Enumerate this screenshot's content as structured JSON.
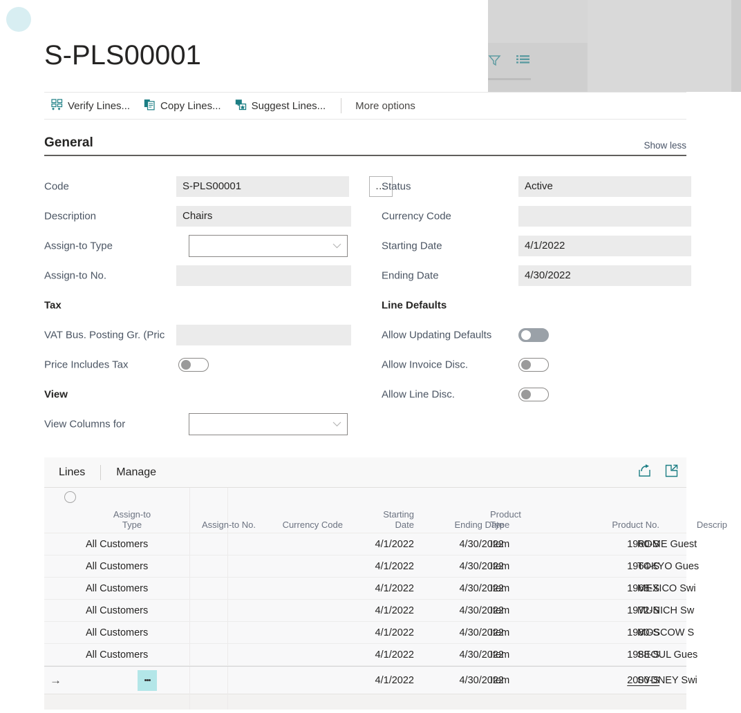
{
  "window": {
    "title": "S-PLS00001"
  },
  "avatar": {
    "color": "#d8eef2"
  },
  "background_panel": {
    "filter_icon": "filter-icon",
    "list_icon": "list-icon"
  },
  "commandbar": {
    "items": [
      {
        "label": "Verify Lines...",
        "icon": "verify-lines-icon"
      },
      {
        "label": "Copy Lines...",
        "icon": "copy-lines-icon"
      },
      {
        "label": "Suggest Lines...",
        "icon": "suggest-lines-icon"
      }
    ],
    "more_options": "More options"
  },
  "general": {
    "title": "General",
    "show_less": "Show less",
    "left": {
      "code_label": "Code",
      "code_value": "S-PLS00001",
      "assist_button": "…",
      "description_label": "Description",
      "description_value": "Chairs",
      "assign_to_type_label": "Assign-to Type",
      "assign_to_type_value": "",
      "assign_to_no_label": "Assign-to No.",
      "assign_to_no_value": "",
      "tax_heading": "Tax",
      "vat_label": "VAT Bus. Posting Gr. (Pric",
      "vat_value": "",
      "price_includes_tax_label": "Price Includes Tax",
      "price_includes_tax_on": false,
      "view_heading": "View",
      "view_columns_for_label": "View Columns for",
      "view_columns_for_value": ""
    },
    "right": {
      "status_label": "Status",
      "status_value": "Active",
      "currency_code_label": "Currency Code",
      "currency_code_value": "",
      "starting_date_label": "Starting Date",
      "starting_date_value": "4/1/2022",
      "ending_date_label": "Ending Date",
      "ending_date_value": "4/30/2022",
      "line_defaults_heading": "Line Defaults",
      "allow_updating_defaults_label": "Allow Updating Defaults",
      "allow_updating_defaults_on": true,
      "allow_invoice_disc_label": "Allow Invoice Disc.",
      "allow_invoice_disc_on": false,
      "allow_line_disc_label": "Allow Line Disc.",
      "allow_line_disc_on": false
    }
  },
  "lines": {
    "tabs": [
      {
        "label": "Lines",
        "active": true
      },
      {
        "label": "Manage",
        "active": false
      }
    ],
    "icons": [
      {
        "name": "share-icon"
      },
      {
        "name": "open-in-new-window-icon"
      }
    ],
    "columns": [
      "Assign-to Type",
      "Assign-to No.",
      "Currency Code",
      "Starting Date",
      "Ending Date",
      "Product Type",
      "Product No.",
      "Descrip"
    ],
    "rows": [
      {
        "assign_to_type": "All Customers",
        "assign_to_no": "",
        "currency_code": "",
        "starting_date": "4/1/2022",
        "ending_date": "4/30/2022",
        "product_type": "Item",
        "product_no": "1960-S",
        "description": "ROME Guest",
        "selected": false
      },
      {
        "assign_to_type": "All Customers",
        "assign_to_no": "",
        "currency_code": "",
        "starting_date": "4/1/2022",
        "ending_date": "4/30/2022",
        "product_type": "Item",
        "product_no": "1964-S",
        "description": "TOKYO Gues",
        "selected": false
      },
      {
        "assign_to_type": "All Customers",
        "assign_to_no": "",
        "currency_code": "",
        "starting_date": "4/1/2022",
        "ending_date": "4/30/2022",
        "product_type": "Item",
        "product_no": "1968-S",
        "description": "MEXICO Swi",
        "selected": false
      },
      {
        "assign_to_type": "All Customers",
        "assign_to_no": "",
        "currency_code": "",
        "starting_date": "4/1/2022",
        "ending_date": "4/30/2022",
        "product_type": "Item",
        "product_no": "1972-S",
        "description": "MUNICH Sw",
        "selected": false
      },
      {
        "assign_to_type": "All Customers",
        "assign_to_no": "",
        "currency_code": "",
        "starting_date": "4/1/2022",
        "ending_date": "4/30/2022",
        "product_type": "Item",
        "product_no": "1980-S",
        "description": "MOSCOW S",
        "selected": false
      },
      {
        "assign_to_type": "All Customers",
        "assign_to_no": "",
        "currency_code": "",
        "starting_date": "4/1/2022",
        "ending_date": "4/30/2022",
        "product_type": "Item",
        "product_no": "1988-S",
        "description": "SEOUL Gues",
        "selected": false
      },
      {
        "assign_to_type": "",
        "assign_to_no": "",
        "currency_code": "",
        "starting_date": "4/1/2022",
        "ending_date": "4/30/2022",
        "product_type": "Item",
        "product_no": "2000-S",
        "description": "SYDNEY Swi",
        "selected": true
      }
    ]
  },
  "colors": {
    "accent_teal": "#1c7e84",
    "selection_teal": "#b3e6e8",
    "field_bg": "#ebebeb",
    "avatar": "#d8eef2"
  }
}
